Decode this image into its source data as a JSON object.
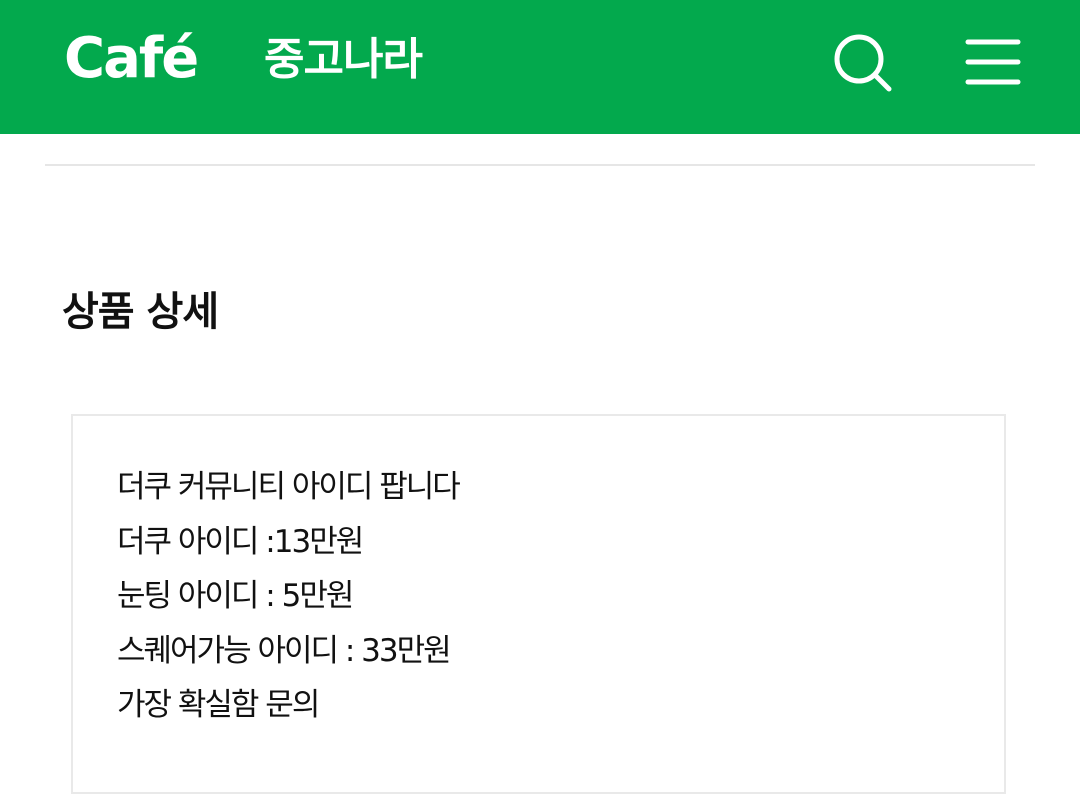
{
  "header": {
    "logo": "Café",
    "cafe_name": "중고나라",
    "background_color": "#03a94d",
    "search_icon": "search-icon",
    "menu_icon": "hamburger-menu-icon"
  },
  "main": {
    "section_title": "상품 상세",
    "detail_lines": [
      "더쿠 커뮤니티 아이디 팝니다",
      "더쿠 아이디 :13만원",
      "눈팅 아이디 : 5만원",
      "스퀘어가능 아이디 : 33만원",
      "가장 확실함 문의"
    ]
  }
}
